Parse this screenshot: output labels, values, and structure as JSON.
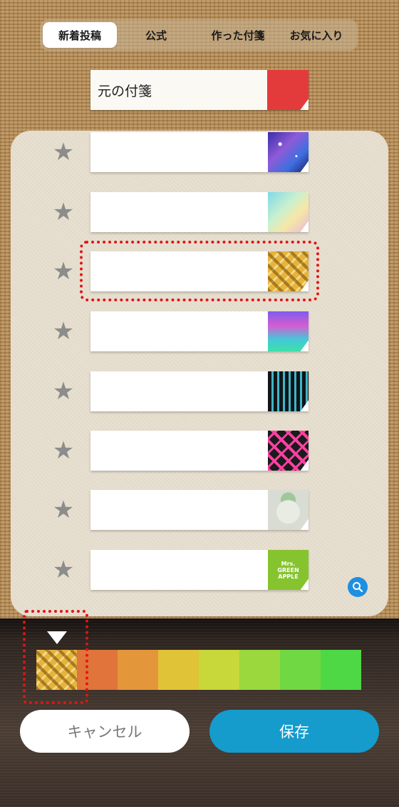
{
  "tabs": [
    {
      "label": "新着投稿",
      "active": true
    },
    {
      "label": "公式",
      "active": false
    },
    {
      "label": "作った付箋",
      "active": false
    },
    {
      "label": "お気に入り",
      "active": false
    }
  ],
  "original": {
    "label": "元の付箋",
    "color": "#e33b3b"
  },
  "stickies": [
    {
      "pattern": "galaxy-icon",
      "star": "★"
    },
    {
      "pattern": "pastel-watercolor-icon",
      "star": "★"
    },
    {
      "pattern": "gold-plaid-icon",
      "star": "★",
      "selected": true
    },
    {
      "pattern": "purple-teal-gradient-icon",
      "star": "★"
    },
    {
      "pattern": "black-teal-stripes-icon",
      "star": "★"
    },
    {
      "pattern": "pink-plaid-icon",
      "star": "★"
    },
    {
      "pattern": "character-icon",
      "star": "★"
    },
    {
      "pattern": "green-apple-icon",
      "star": "★",
      "text": "Mrs.\nGREEN\nAPPLE"
    }
  ],
  "palette": {
    "colors": [
      "#e0b440",
      "#e0743a",
      "#e3973a",
      "#e0c336",
      "#c8d83a",
      "#9ad83e",
      "#6fd842",
      "#4fd846",
      "#3fd84a"
    ],
    "selected_index": 0
  },
  "buttons": {
    "cancel": "キャンセル",
    "save": "保存"
  },
  "accent": "#159bcc"
}
